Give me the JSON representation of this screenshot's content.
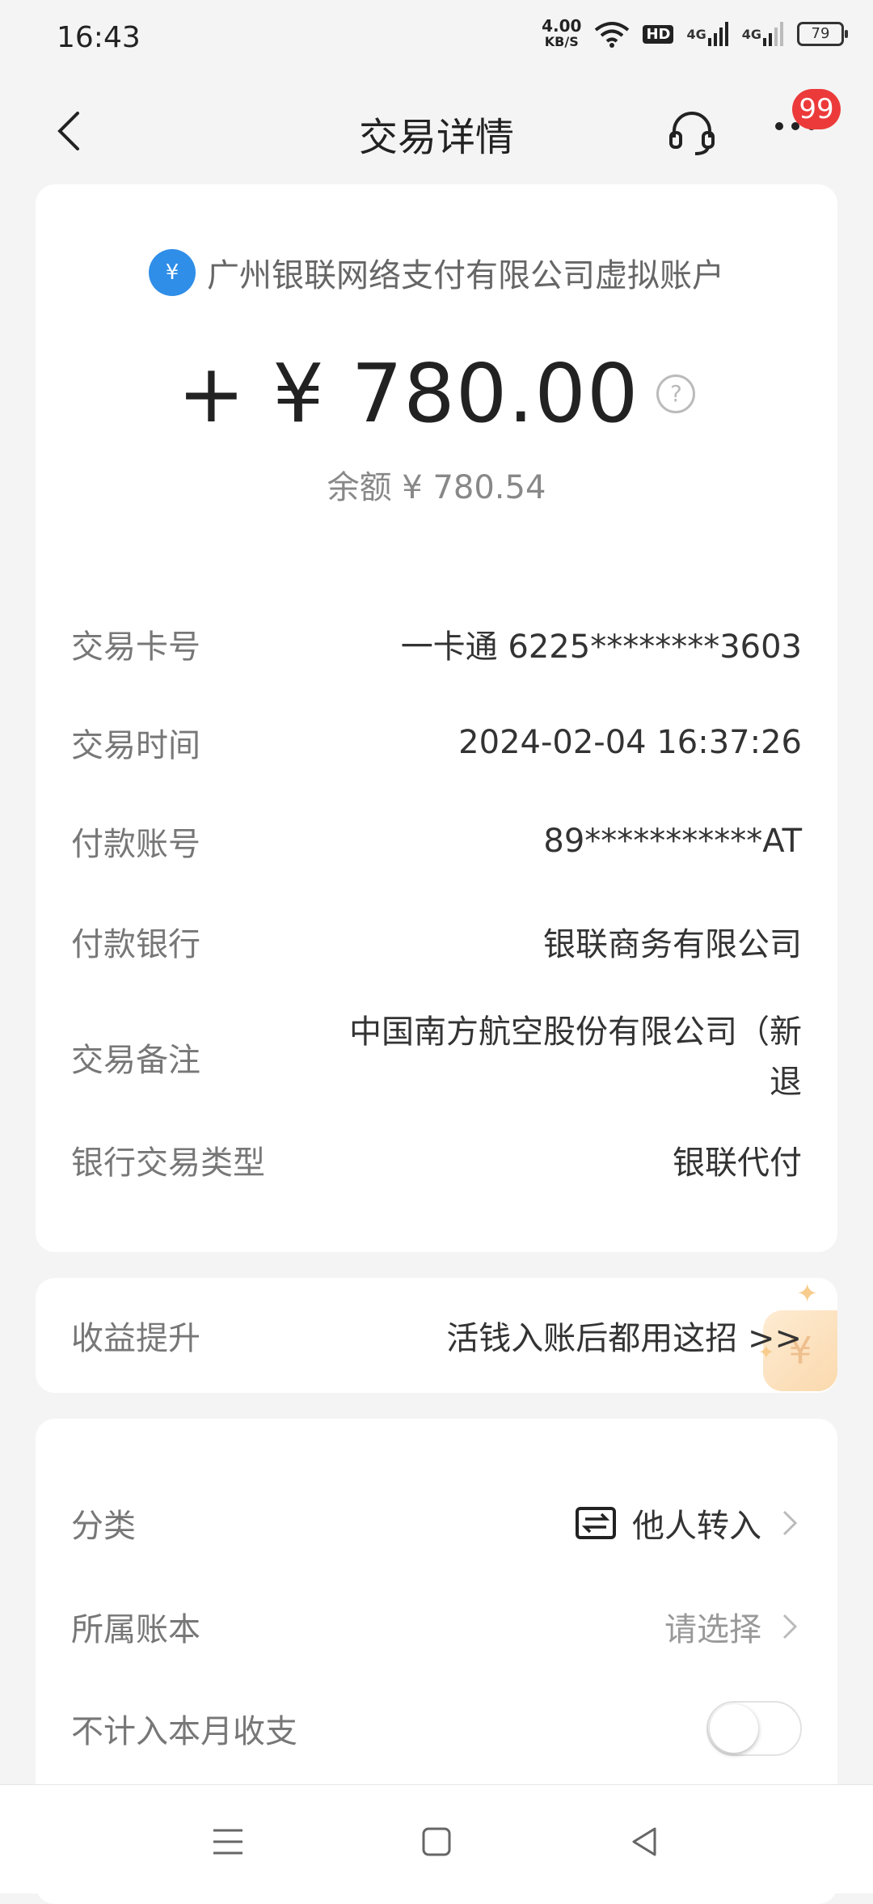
{
  "status_bar": {
    "time": "16:43",
    "net_speed_value": "4.00",
    "net_speed_unit": "KB/S",
    "hd_label": "HD",
    "network_1": "4G",
    "network_2": "4G",
    "battery": "79",
    "icons": [
      "wifi-icon",
      "signal-icon",
      "signal-icon",
      "battery-icon"
    ]
  },
  "header": {
    "title": "交易详情",
    "badge_count": "99",
    "icons": [
      "back-icon",
      "headset-icon",
      "more-icon"
    ]
  },
  "summary": {
    "merchant": "广州银联网络支付有限公司虚拟账户",
    "merchant_icon_glyph": "¥",
    "amount": "+ ¥ 780.00",
    "help_glyph": "?",
    "balance": "余额 ¥ 780.54"
  },
  "details": [
    {
      "label": "交易卡号",
      "value": "一卡通 6225********3603"
    },
    {
      "label": "交易时间",
      "value": "2024-02-04 16:37:26"
    },
    {
      "label": "付款账号",
      "value": "89***********AT"
    },
    {
      "label": "付款银行",
      "value": "银联商务有限公司"
    },
    {
      "label": "交易备注",
      "value": "中国南方航空股份有限公司（新退"
    },
    {
      "label": "银行交易类型",
      "value": "银联代付"
    }
  ],
  "promo": {
    "label": "收益提升",
    "value": "活钱入账后都用这招 >>",
    "deco_glyph": "¥"
  },
  "settings": {
    "category_label": "分类",
    "category_value": "他人转入",
    "ledger_label": "所属账本",
    "ledger_value": "请选择",
    "exclude_label": "不计入本月收支",
    "exclude_enabled": false
  },
  "colors": {
    "background": "#f4f4f4",
    "badge": "#ec3a3a",
    "merchant_icon": "#2f8ee8"
  }
}
